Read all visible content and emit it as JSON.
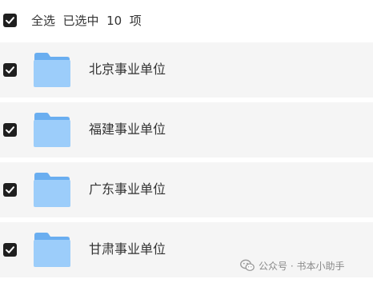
{
  "header": {
    "label": "全选  已选中  10  项",
    "checked": true
  },
  "items": [
    {
      "label": "北京事业单位",
      "checked": true,
      "icon": "folder-icon"
    },
    {
      "label": "福建事业单位",
      "checked": true,
      "icon": "folder-icon"
    },
    {
      "label": "广东事业单位",
      "checked": true,
      "icon": "folder-icon"
    },
    {
      "label": "甘肃事业单位",
      "checked": true,
      "icon": "folder-icon"
    }
  ],
  "watermark": {
    "text": "公众号 · 书本小助手",
    "icon": "wechat-icon"
  },
  "colors": {
    "checkbox": "#1f1f1f",
    "row_background": "#f5f5f5",
    "folder_light": "#9ccdfa",
    "folder_dark": "#6aaef0"
  }
}
